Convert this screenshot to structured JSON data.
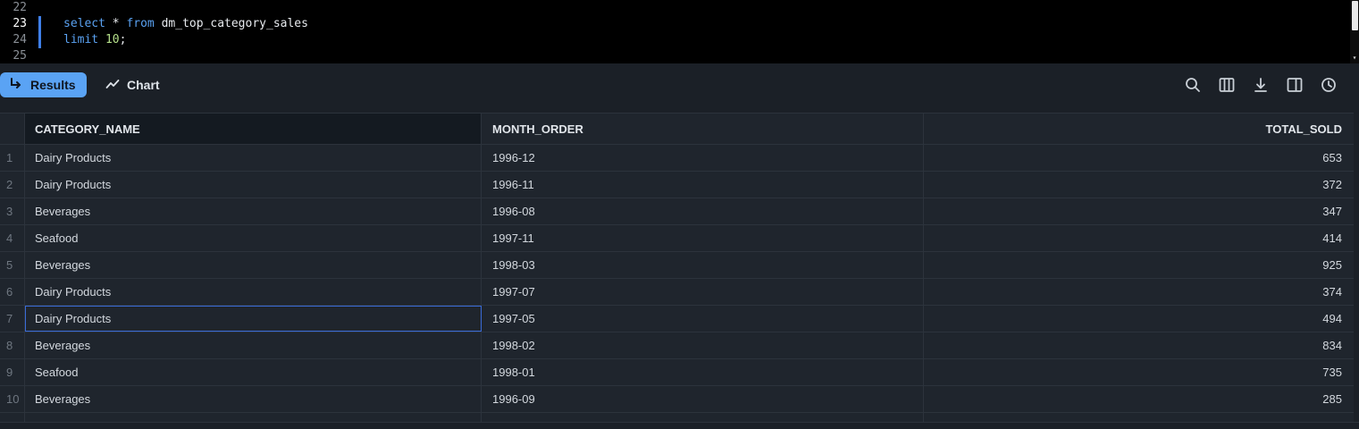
{
  "editor": {
    "lines": [
      {
        "num": "22",
        "active": false,
        "code": []
      },
      {
        "num": "23",
        "active": true,
        "code": [
          {
            "t": "kw",
            "text": "select"
          },
          {
            "t": "plain",
            "text": " * "
          },
          {
            "t": "kw",
            "text": "from"
          },
          {
            "t": "plain",
            "text": " dm_top_category_sales"
          }
        ]
      },
      {
        "num": "24",
        "active": false,
        "code": [
          {
            "t": "kw",
            "text": "limit"
          },
          {
            "t": "plain",
            "text": " "
          },
          {
            "t": "num",
            "text": "10"
          },
          {
            "t": "plain",
            "text": ";"
          }
        ]
      },
      {
        "num": "25",
        "active": false,
        "code": []
      }
    ]
  },
  "toolbar": {
    "results_label": "Results",
    "chart_label": "Chart",
    "icons": [
      "search-icon",
      "columns-icon",
      "download-icon",
      "split-panel-icon",
      "history-icon"
    ]
  },
  "table": {
    "columns": [
      "CATEGORY_NAME",
      "MONTH_ORDER",
      "TOTAL_SOLD"
    ],
    "rows": [
      {
        "n": "1",
        "category": "Dairy Products",
        "month": "1996-12",
        "total": "653"
      },
      {
        "n": "2",
        "category": "Dairy Products",
        "month": "1996-11",
        "total": "372"
      },
      {
        "n": "3",
        "category": "Beverages",
        "month": "1996-08",
        "total": "347"
      },
      {
        "n": "4",
        "category": "Seafood",
        "month": "1997-11",
        "total": "414"
      },
      {
        "n": "5",
        "category": "Beverages",
        "month": "1998-03",
        "total": "925"
      },
      {
        "n": "6",
        "category": "Dairy Products",
        "month": "1997-07",
        "total": "374"
      },
      {
        "n": "7",
        "category": "Dairy Products",
        "month": "1997-05",
        "total": "494"
      },
      {
        "n": "8",
        "category": "Beverages",
        "month": "1998-02",
        "total": "834"
      },
      {
        "n": "9",
        "category": "Seafood",
        "month": "1998-01",
        "total": "735"
      },
      {
        "n": "10",
        "category": "Beverages",
        "month": "1996-09",
        "total": "285"
      }
    ],
    "selected_row": 7
  },
  "colors": {
    "accent": "#5aa3f4",
    "keyword": "#5aa2f2",
    "number": "#b5e08a",
    "selection": "#3a6bd8"
  }
}
